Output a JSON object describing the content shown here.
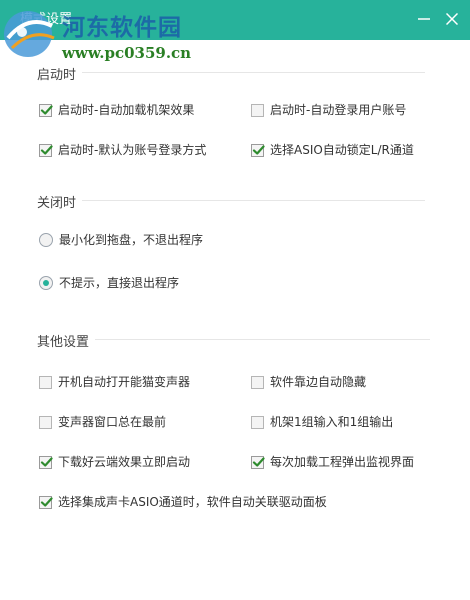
{
  "window": {
    "title": "模式设置",
    "accent_color": "#27b29b",
    "minimize_icon": "minimize-icon",
    "close_icon": "close-icon"
  },
  "watermark": {
    "site_name": "河东软件园",
    "url": "www.pc0359.cn"
  },
  "sections": {
    "startup": {
      "title": "启动时",
      "options": [
        {
          "label": "启动时-自动加载机架效果",
          "checked": true
        },
        {
          "label": "启动时-自动登录用户账号",
          "checked": false
        },
        {
          "label": "启动时-默认为账号登录方式",
          "checked": true
        },
        {
          "label": "选择ASIO自动锁定L/R通道",
          "checked": true
        }
      ]
    },
    "close": {
      "title": "关闭时",
      "options": [
        {
          "label": "最小化到拖盘，不退出程序",
          "selected": false
        },
        {
          "label": "不提示，直接退出程序",
          "selected": true
        }
      ]
    },
    "other": {
      "title": "其他设置",
      "options": [
        {
          "label": "开机自动打开能猫变声器",
          "checked": false
        },
        {
          "label": "软件靠边自动隐藏",
          "checked": false
        },
        {
          "label": "变声器窗口总在最前",
          "checked": false
        },
        {
          "label": "机架1组输入和1组输出",
          "checked": false
        },
        {
          "label": "下载好云端效果立即启动",
          "checked": true
        },
        {
          "label": "每次加载工程弹出监视界面",
          "checked": true
        },
        {
          "label": "选择集成声卡ASIO通道时，软件自动关联驱动面板",
          "checked": true
        }
      ]
    }
  }
}
